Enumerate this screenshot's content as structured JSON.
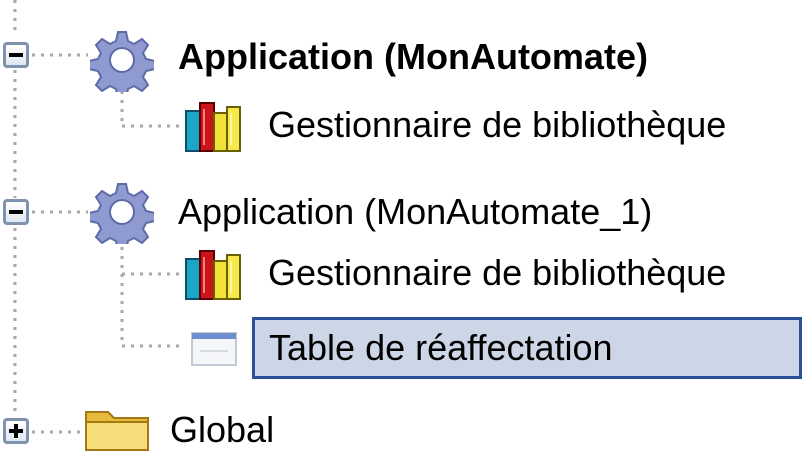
{
  "tree": {
    "nodes": [
      {
        "label": "Application (MonAutomate)",
        "icon": "gear-icon",
        "expander": "minus",
        "bold": true
      },
      {
        "label": "Gestionnaire de bibliothèque",
        "icon": "library-books-icon"
      },
      {
        "label": "Application (MonAutomate_1)",
        "icon": "gear-icon",
        "expander": "minus"
      },
      {
        "label": "Gestionnaire de bibliothèque",
        "icon": "library-books-icon"
      },
      {
        "label": "Table de réaffectation",
        "icon": "table-icon",
        "selected": true
      },
      {
        "label": "Global",
        "icon": "folder-icon",
        "expander": "plus"
      }
    ]
  },
  "colors": {
    "selection_fill": "#cdd6e6",
    "selection_border": "#2a4f9c",
    "expander_border": "#7f93ad",
    "guide_line": "#a8a8a8"
  }
}
